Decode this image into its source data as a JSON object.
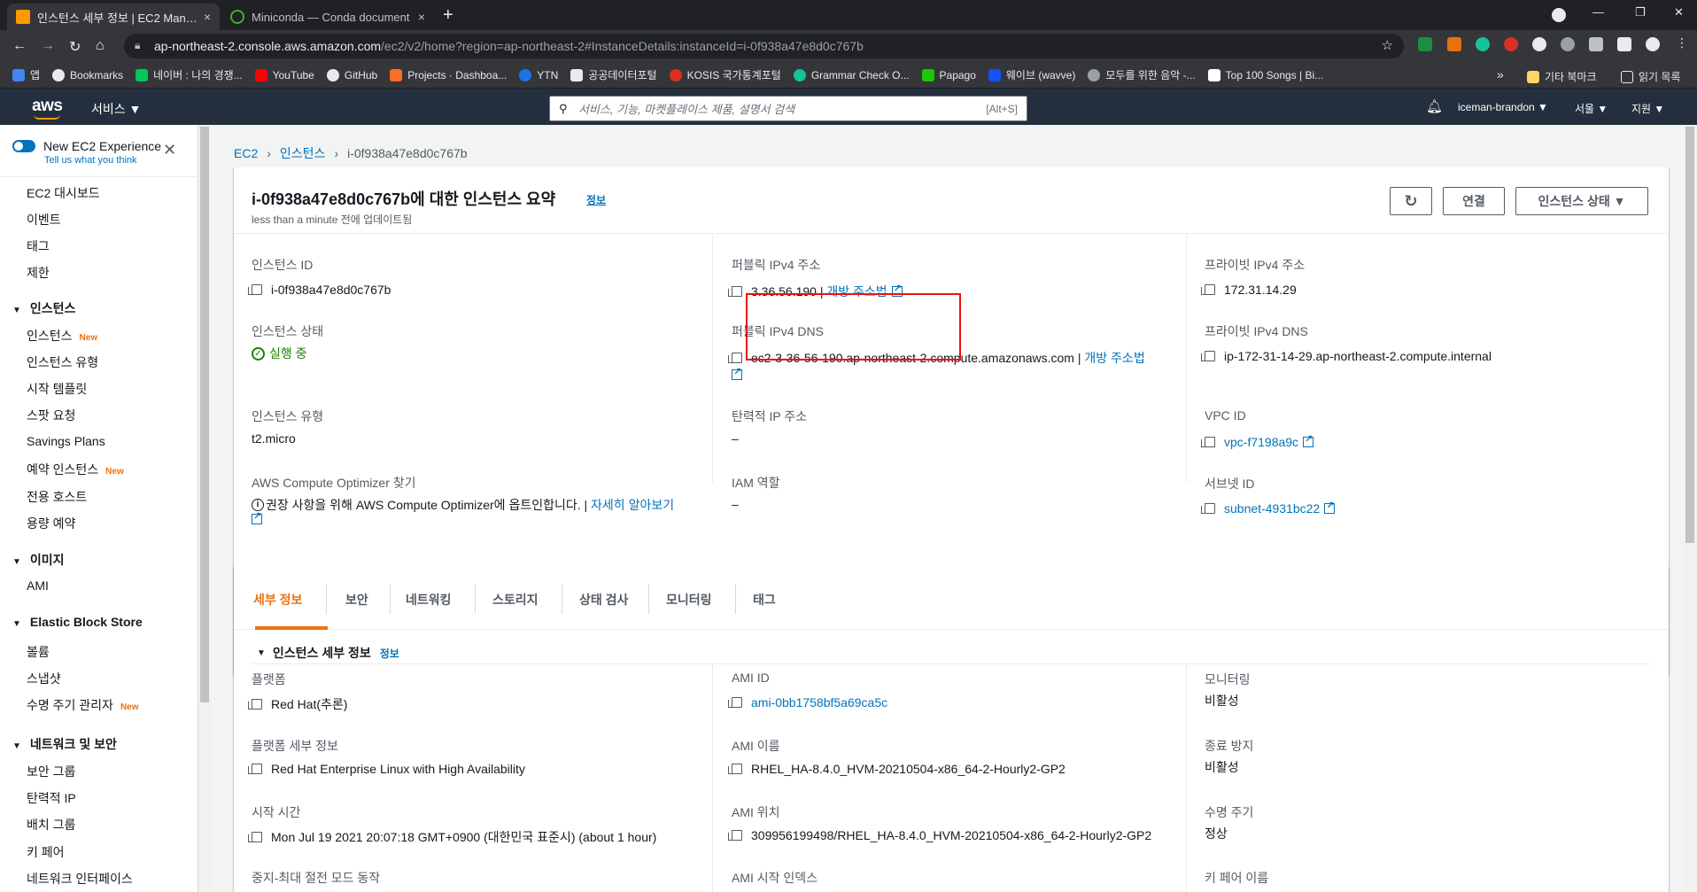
{
  "browser": {
    "tabs": [
      {
        "title": "인스턴스 세부 정보 | EC2 Manag",
        "close": "×"
      },
      {
        "title": "Miniconda — Conda document",
        "close": "×"
      }
    ],
    "new_tab": "+",
    "window_controls": {
      "minimize": "—",
      "restore": "❐",
      "close": "✕"
    },
    "url_domain": "ap-northeast-2.console.aws.amazon.com",
    "url_path": "/ec2/v2/home?region=ap-northeast-2#InstanceDetails:instanceId=i-0f938a47e8d0c767b",
    "bookmarks": [
      {
        "label": "앱",
        "color": "#4285f4"
      },
      {
        "label": "Bookmarks",
        "color": "#e8eaed"
      },
      {
        "label": "네이버 : 나의 경쟁...",
        "color": "#03c75a"
      },
      {
        "label": "YouTube",
        "color": "#ff0000"
      },
      {
        "label": "GitHub",
        "color": "#e8eaed"
      },
      {
        "label": "Projects · Dashboa...",
        "color": "#fc6d26"
      },
      {
        "label": "YTN",
        "color": "#1a73e8"
      },
      {
        "label": "공공데이터포털",
        "color": "#e8eaed"
      },
      {
        "label": "KOSIS 국가통계포털",
        "color": "#d93025"
      },
      {
        "label": "Grammar Check O...",
        "color": "#15c39a"
      },
      {
        "label": "Papago",
        "color": "#1ec800"
      },
      {
        "label": "웨이브 (wavve)",
        "color": "#1351f9"
      },
      {
        "label": "모두를 위한 음악 -...",
        "color": "#444"
      },
      {
        "label": "Top 100 Songs | Bi...",
        "color": "#000"
      }
    ],
    "bookmark_more": "»",
    "other_bookmarks": "기타 북마크",
    "reading_list": "읽기 목록"
  },
  "aws_nav": {
    "logo": "aws",
    "services": "서비스 ▼",
    "search_placeholder": "서비스, 기능, 마켓플레이스 제품, 설명서 검색",
    "search_shortcut": "[Alt+S]",
    "account": "iceman-brandon ▼",
    "region": "서울 ▼",
    "support": "지원 ▼"
  },
  "sidebar": {
    "new_experience": "New EC2 Experience",
    "tell_us": "Tell us what you think",
    "top_items": [
      "EC2 대시보드",
      "이벤트",
      "태그",
      "제한"
    ],
    "sections": [
      {
        "title": "인스턴스",
        "items": [
          {
            "label": "인스턴스",
            "new": "New"
          },
          {
            "label": "인스턴스 유형",
            "new": ""
          },
          {
            "label": "시작 템플릿",
            "new": ""
          },
          {
            "label": "스팟 요청",
            "new": ""
          },
          {
            "label": "Savings Plans",
            "new": ""
          },
          {
            "label": "예약 인스턴스",
            "new": "New"
          },
          {
            "label": "전용 호스트",
            "new": ""
          },
          {
            "label": "용량 예약",
            "new": ""
          }
        ]
      },
      {
        "title": "이미지",
        "items": [
          {
            "label": "AMI",
            "new": ""
          }
        ]
      },
      {
        "title": "Elastic Block Store",
        "items": [
          {
            "label": "볼륨",
            "new": ""
          },
          {
            "label": "스냅샷",
            "new": ""
          },
          {
            "label": "수명 주기 관리자",
            "new": "New"
          }
        ]
      },
      {
        "title": "네트워크 및 보안",
        "items": [
          {
            "label": "보안 그룹",
            "new": ""
          },
          {
            "label": "탄력적 IP",
            "new": ""
          },
          {
            "label": "배치 그룹",
            "new": ""
          },
          {
            "label": "키 페어",
            "new": ""
          },
          {
            "label": "네트워크 인터페이스",
            "new": ""
          }
        ]
      }
    ]
  },
  "breadcrumb": {
    "ec2": "EC2",
    "instances": "인스턴스",
    "current": "i-0f938a47e8d0c767b"
  },
  "summary": {
    "title": "i-0f938a47e8d0c767b에 대한 인스턴스 요약",
    "info": "정보",
    "updated": "less than a minute 전에 업데이트됨",
    "refresh": "↻",
    "connect": "연결",
    "state_button": "인스턴스 상태 ▼",
    "fields": {
      "instance_id_label": "인스턴스 ID",
      "instance_id": "i-0f938a47e8d0c767b",
      "public_ipv4_label": "퍼블릭 IPv4 주소",
      "public_ipv4": "3.36.56.190",
      "open_address": "개방 주소법",
      "private_ipv4_label": "프라이빗 IPv4 주소",
      "private_ipv4": "172.31.14.29",
      "state_label": "인스턴스 상태",
      "state": "실행 중",
      "public_dns_label": "퍼블릭 IPv4 DNS",
      "public_dns": "ec2-3-36-56-190.ap-northeast-2.compute.amazonaws.com",
      "private_dns_label": "프라이빗 IPv4 DNS",
      "private_dns": "ip-172-31-14-29.ap-northeast-2.compute.internal",
      "type_label": "인스턴스 유형",
      "type": "t2.micro",
      "elastic_ip_label": "탄력적 IP 주소",
      "elastic_ip": "–",
      "vpc_label": "VPC ID",
      "vpc": "vpc-f7198a9c",
      "optimizer_label": "AWS Compute Optimizer 찾기",
      "optimizer_text": "권장 사항을 위해 AWS Compute Optimizer에 옵트인합니다. |",
      "optimizer_link": "자세히 알아보기",
      "iam_label": "IAM 역할",
      "iam": "–",
      "subnet_label": "서브넷 ID",
      "subnet": "subnet-4931bc22"
    }
  },
  "details": {
    "tabs": [
      "세부 정보",
      "보안",
      "네트워킹",
      "스토리지",
      "상태 검사",
      "모니터링",
      "태그"
    ],
    "section_title": "인스턴스 세부 정보",
    "section_info": "정보",
    "platform_label": "플랫폼",
    "platform": "Red Hat(추론)",
    "ami_id_label": "AMI ID",
    "ami_id": "ami-0bb1758bf5a69ca5c",
    "monitoring_label": "모니터링",
    "monitoring": "비활성",
    "platform_detail_label": "플랫폼 세부 정보",
    "platform_detail": "Red Hat Enterprise Linux with High Availability",
    "ami_name_label": "AMI 이름",
    "ami_name": "RHEL_HA-8.4.0_HVM-20210504-x86_64-2-Hourly2-GP2",
    "termination_label": "종료 방지",
    "termination": "비활성",
    "launch_time_label": "시작 시간",
    "launch_time": "Mon Jul 19 2021 20:07:18 GMT+0900 (대한민국 표준시) (about 1 hour)",
    "ami_location_label": "AMI 위치",
    "ami_location": "309956199498/RHEL_HA-8.4.0_HVM-20210504-x86_64-2-Hourly2-GP2",
    "lifecycle_label": "수명 주기",
    "lifecycle": "정상",
    "stop_hibernate_label": "중지-최대 절전 모드 동작",
    "ami_launch_index_label": "AMI 시작 인덱스",
    "key_pair_label": "키 페어 이름"
  }
}
